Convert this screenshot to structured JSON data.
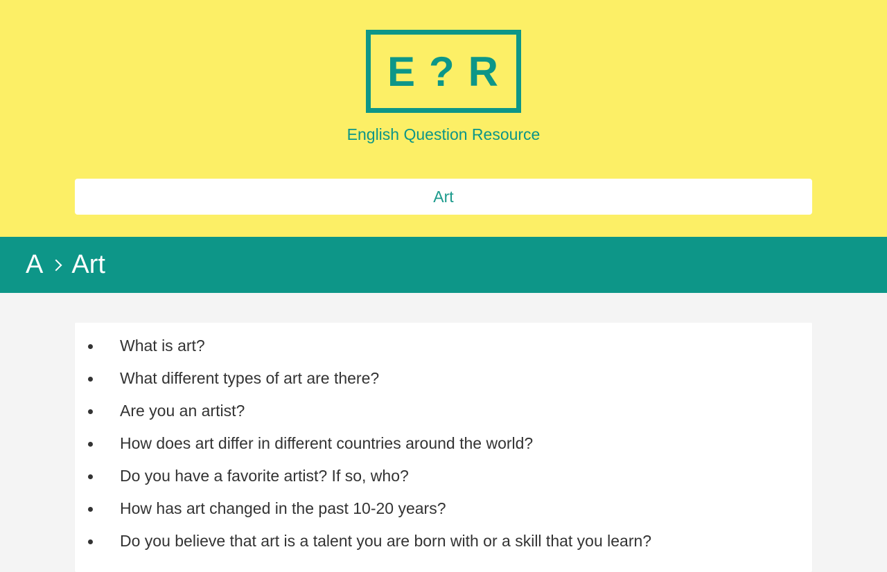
{
  "logo": {
    "letters": [
      "E",
      "?",
      "R"
    ]
  },
  "site_title": "English Question Resource",
  "search": {
    "value": "Art"
  },
  "breadcrumb": {
    "letter": "A",
    "topic": "Art"
  },
  "questions": [
    "What is art?",
    "What different types of art are there?",
    "Are you an artist?",
    "How does art differ in different countries around the world?",
    "Do you have a favorite artist? If so, who?",
    "How has art changed in the past 10-20 years?",
    "Do you believe that art is a talent you are born with or a skill that you learn?"
  ],
  "colors": {
    "header_bg": "#fcef66",
    "accent": "#0d9688",
    "page_bg": "#f4f4f4",
    "text": "#333333"
  }
}
